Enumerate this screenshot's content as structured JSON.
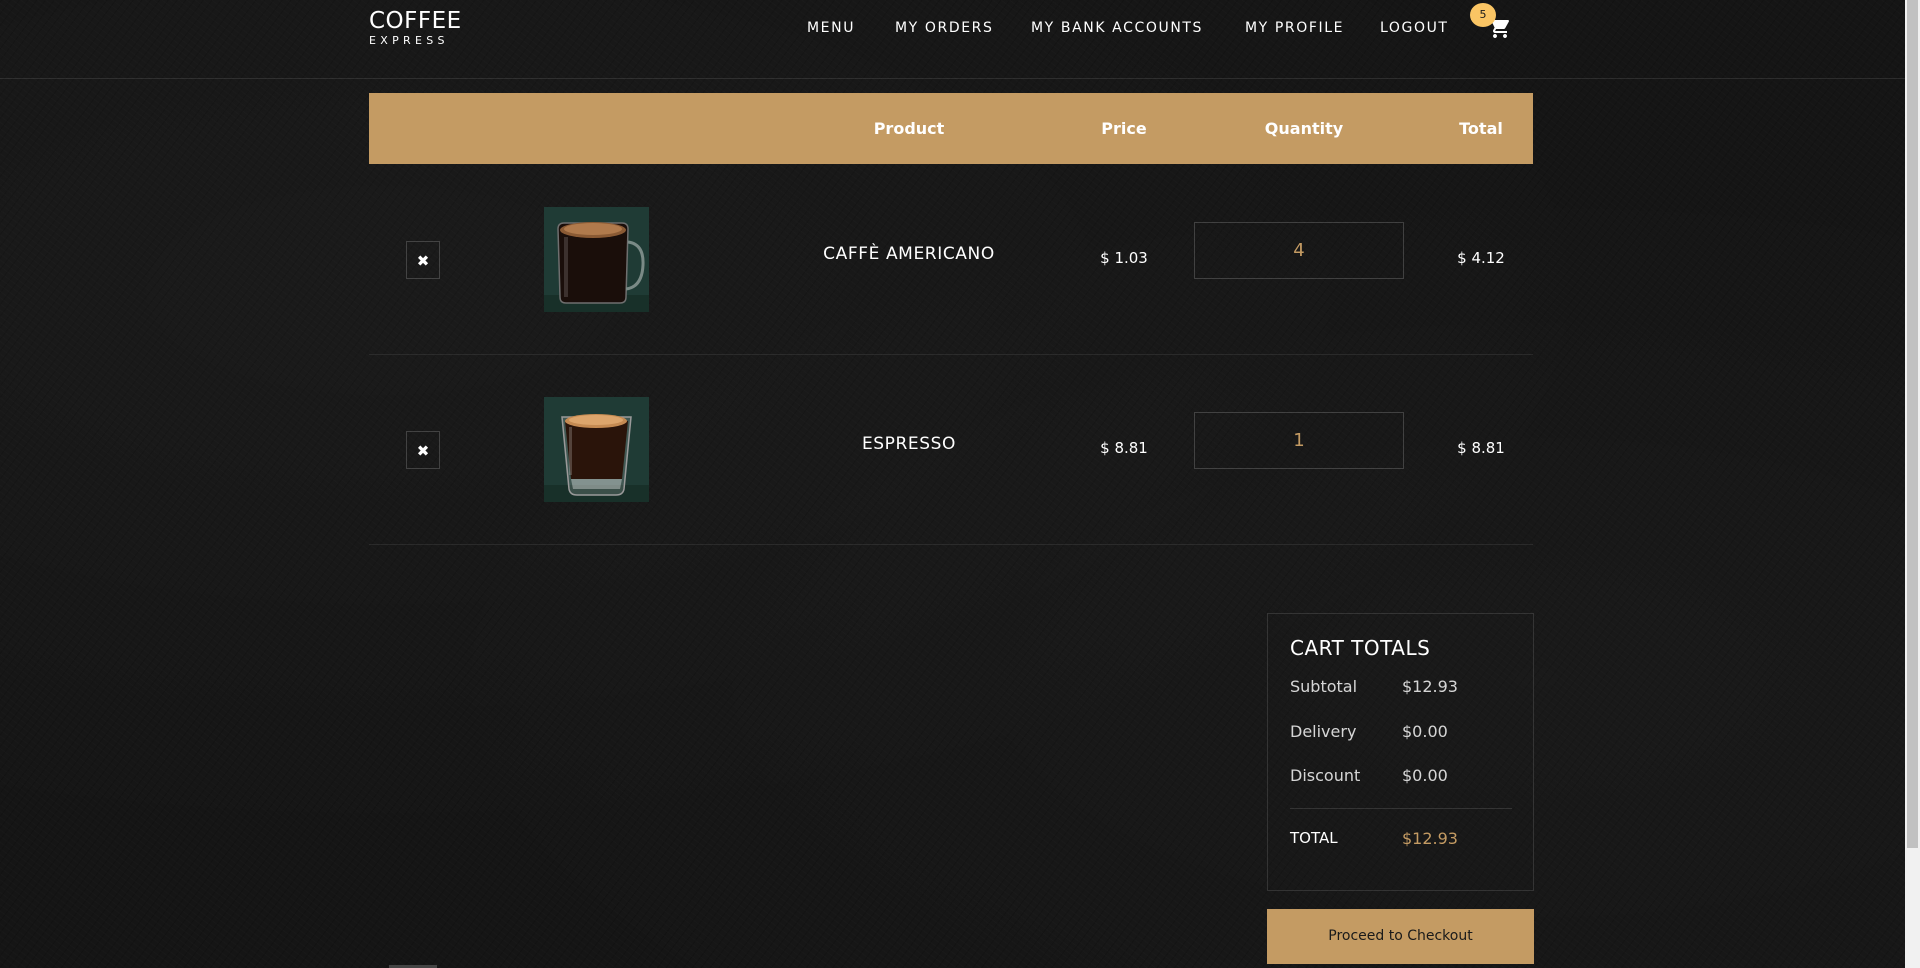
{
  "brand": {
    "name": "COFFEE",
    "subtitle": "EXPRESS"
  },
  "nav": {
    "items": [
      {
        "label": "MENU"
      },
      {
        "label": "MY ORDERS"
      },
      {
        "label": "MY BANK ACCOUNTS"
      },
      {
        "label": "MY PROFILE"
      },
      {
        "label": "LOGOUT"
      }
    ],
    "cart_icon": "shopping-cart-icon",
    "cart_count": "5"
  },
  "cart_table": {
    "headers": {
      "product": "Product",
      "price": "Price",
      "quantity": "Quantity",
      "total": "Total"
    },
    "rows": [
      {
        "remove_icon": "close-icon",
        "remove_glyph": "✖",
        "image_icon": "americano-mug-image",
        "name": "CAFFÈ AMERICANO",
        "price": "$ 1.03",
        "quantity": "4",
        "total": "$ 4.12"
      },
      {
        "remove_icon": "close-icon",
        "remove_glyph": "✖",
        "image_icon": "espresso-glass-image",
        "name": "ESPRESSO",
        "price": "$ 8.81",
        "quantity": "1",
        "total": "$ 8.81"
      }
    ]
  },
  "cart_totals": {
    "title": "CART TOTALS",
    "subtotal_label": "Subtotal",
    "subtotal_value": "$12.93",
    "delivery_label": "Delivery",
    "delivery_value": "$0.00",
    "discount_label": "Discount",
    "discount_value": "$0.00",
    "total_label": "TOTAL",
    "total_value": "$12.93"
  },
  "checkout_label": "Proceed to Checkout",
  "colors": {
    "accent": "#c49b63",
    "badge": "#fac564",
    "background": "#151515"
  }
}
